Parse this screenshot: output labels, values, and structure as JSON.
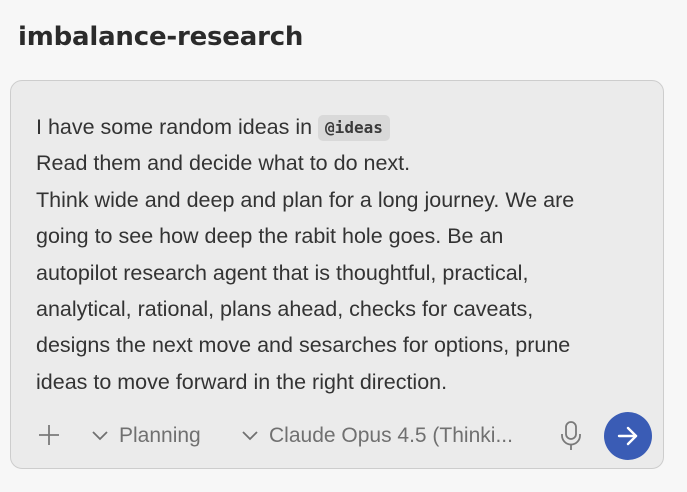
{
  "header": {
    "title": "imbalance-research"
  },
  "composer": {
    "prompt": {
      "line1_text": "I have some random ideas in ",
      "mention": "@ideas",
      "lines": [
        "Read them and decide what to do next.",
        "Think wide and deep and plan for a long journey. We are",
        "going to see how deep the rabit hole goes. Be an",
        "autopilot research agent that is thoughtful, practical,",
        "analytical, rational, plans ahead, checks for caveats,",
        "designs the next move and sesarches for options, prune",
        "ideas to move forward in the right direction."
      ]
    },
    "toolbar": {
      "add_icon": "plus-icon",
      "mode_label": "Planning",
      "model_label": "Claude Opus 4.5 (Thinki...",
      "mic_icon": "microphone-icon",
      "send_icon": "arrow-right-icon"
    }
  },
  "colors": {
    "accent": "#3a5cb5",
    "composer_bg": "#ebebeb",
    "mention_bg": "#d9d9d9"
  }
}
